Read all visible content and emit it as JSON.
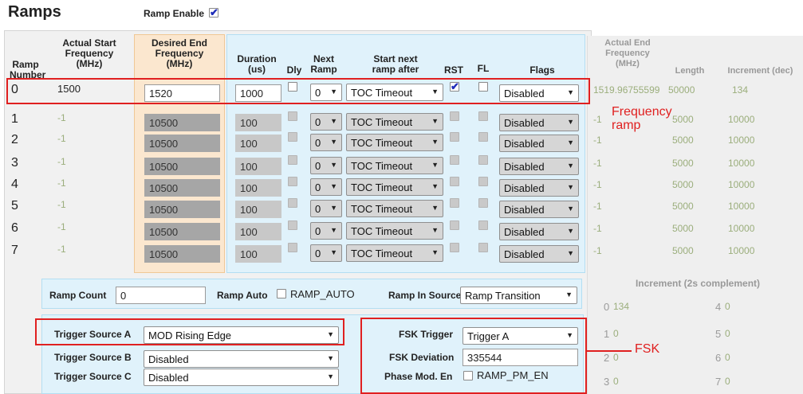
{
  "title": "Ramps",
  "ramp_enable": {
    "label": "Ramp Enable",
    "checked": true
  },
  "headers": {
    "ramp_number": "Ramp\nNumber",
    "actual_start": "Actual Start\nFrequency\n(MHz)",
    "desired_end": "Desired End\nFrequency\n(MHz)",
    "duration": "Duration\n(us)",
    "dly": "Dly",
    "next_ramp": "Next\nRamp",
    "start_next": "Start next\nramp after",
    "rst": "RST",
    "fl": "FL",
    "flags": "Flags",
    "actual_end": "Actual End\nFrequency\n(MHz)",
    "length": "Length",
    "increment": "Increment (dec)"
  },
  "rows": [
    {
      "num": "0",
      "start": "1500",
      "end": "1520",
      "duration": "1000",
      "next": "0",
      "start_after": "TOC Timeout",
      "rst": true,
      "flags": "Disabled",
      "actual_end": "1519.96755599",
      "length": "50000",
      "increment": "134"
    },
    {
      "num": "1",
      "start": "-1",
      "end": "10500",
      "duration": "100",
      "next": "0",
      "start_after": "TOC Timeout",
      "rst": false,
      "flags": "Disabled",
      "actual_end": "-1",
      "length": "5000",
      "increment": "10000"
    },
    {
      "num": "2",
      "start": "-1",
      "end": "10500",
      "duration": "100",
      "next": "0",
      "start_after": "TOC Timeout",
      "rst": false,
      "flags": "Disabled",
      "actual_end": "-1",
      "length": "5000",
      "increment": "10000"
    },
    {
      "num": "3",
      "start": "-1",
      "end": "10500",
      "duration": "100",
      "next": "0",
      "start_after": "TOC Timeout",
      "rst": false,
      "flags": "Disabled",
      "actual_end": "-1",
      "length": "5000",
      "increment": "10000"
    },
    {
      "num": "4",
      "start": "-1",
      "end": "10500",
      "duration": "100",
      "next": "0",
      "start_after": "TOC Timeout",
      "rst": false,
      "flags": "Disabled",
      "actual_end": "-1",
      "length": "5000",
      "increment": "10000"
    },
    {
      "num": "5",
      "start": "-1",
      "end": "10500",
      "duration": "100",
      "next": "0",
      "start_after": "TOC Timeout",
      "rst": false,
      "flags": "Disabled",
      "actual_end": "-1",
      "length": "5000",
      "increment": "10000"
    },
    {
      "num": "6",
      "start": "-1",
      "end": "10500",
      "duration": "100",
      "next": "0",
      "start_after": "TOC Timeout",
      "rst": false,
      "flags": "Disabled",
      "actual_end": "-1",
      "length": "5000",
      "increment": "10000"
    },
    {
      "num": "7",
      "start": "-1",
      "end": "10500",
      "duration": "100",
      "next": "0",
      "start_after": "TOC Timeout",
      "rst": false,
      "flags": "Disabled",
      "actual_end": "-1",
      "length": "5000",
      "increment": "10000"
    }
  ],
  "ramp_count": {
    "label": "Ramp Count",
    "value": "0"
  },
  "ramp_auto": {
    "label": "Ramp Auto",
    "checkbox_label": "RAMP_AUTO"
  },
  "ramp_in_source": {
    "label": "Ramp In Source",
    "value": "Ramp Transition"
  },
  "trigger_a": {
    "label": "Trigger Source A",
    "value": "MOD Rising Edge"
  },
  "trigger_b": {
    "label": "Trigger Source B",
    "value": "Disabled"
  },
  "trigger_c": {
    "label": "Trigger Source C",
    "value": "Disabled"
  },
  "fsk_trigger": {
    "label": "FSK Trigger",
    "value": "Trigger A"
  },
  "fsk_deviation": {
    "label": "FSK Deviation",
    "value": "335544"
  },
  "phase_mod": {
    "label": "Phase Mod. En",
    "checkbox_label": "RAMP_PM_EN"
  },
  "increment_2s": {
    "title": "Increment (2s complement)",
    "items": [
      {
        "idx": "0",
        "val": "134"
      },
      {
        "idx": "1",
        "val": "0"
      },
      {
        "idx": "2",
        "val": "0"
      },
      {
        "idx": "3",
        "val": "0"
      },
      {
        "idx": "4",
        "val": "0"
      },
      {
        "idx": "5",
        "val": "0"
      },
      {
        "idx": "6",
        "val": "0"
      },
      {
        "idx": "7",
        "val": "0"
      }
    ]
  },
  "annotations": {
    "frequency_ramp": "Frequency\nramp",
    "fsk": "FSK"
  },
  "colors": {
    "red": "#e02020",
    "orange_bg": "#fbe7cf",
    "blue_bg": "#e0f2fb",
    "check_blue": "#1f2db8"
  }
}
